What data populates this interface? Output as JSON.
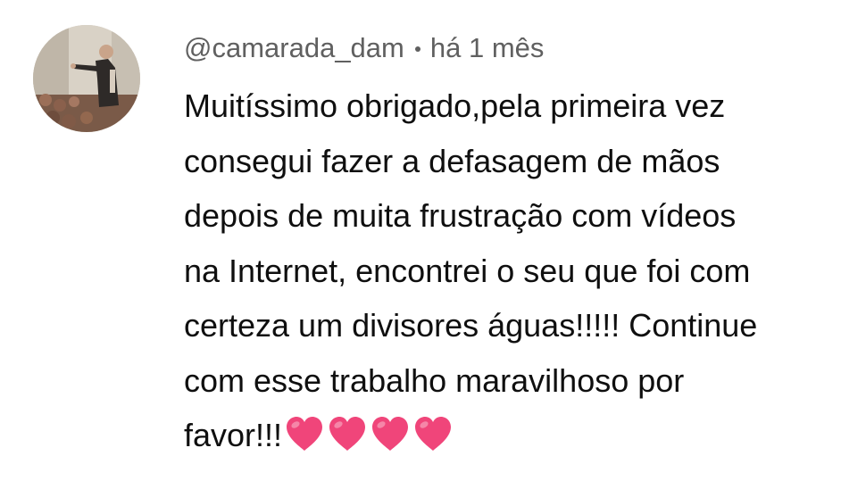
{
  "comment": {
    "author": "@camarada_dam",
    "time": "há 1 mês",
    "lines": [
      "Muitíssimo obrigado,pela primeira vez",
      "consegui fazer a defasagem de mãos",
      "depois de muita frustração com vídeos",
      "na Internet, encontrei o seu que foi com",
      "certeza um divisores águas!!!!! Continue",
      "com esse trabalho maravilhoso por",
      "favor!!!"
    ],
    "heart_count": 4,
    "heart_icon": "heart-emoji",
    "colors": {
      "author_text": "#606060",
      "body_text": "#0f0f0f",
      "heart": "#f0457a"
    }
  }
}
